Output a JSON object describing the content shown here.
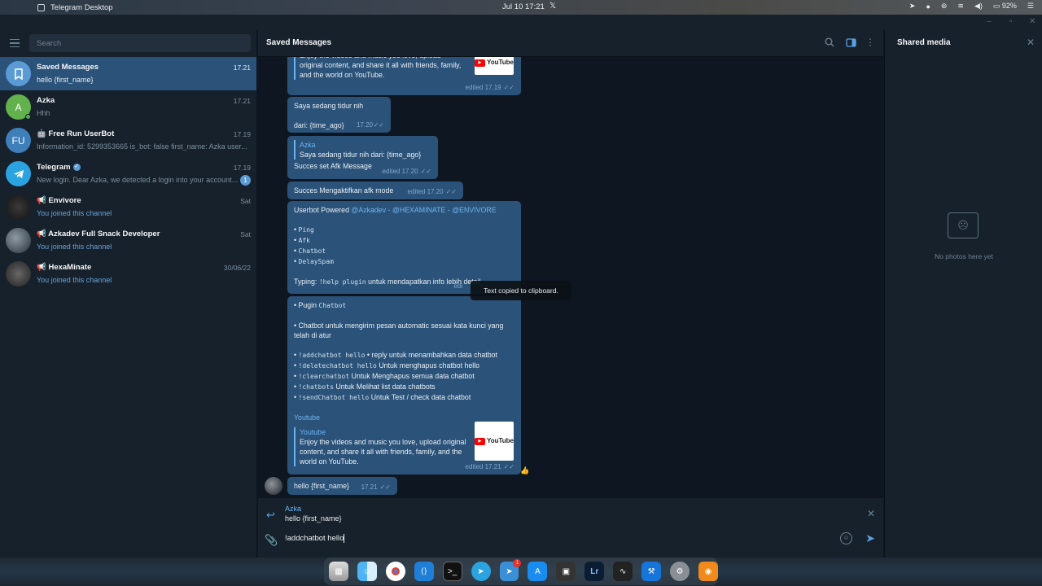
{
  "menubar": {
    "app_title": "Telegram Desktop",
    "date": "Jul 10",
    "time": "17:21",
    "battery": "92%"
  },
  "sidebar": {
    "search_placeholder": "Search",
    "chats": [
      {
        "name": "Saved Messages",
        "preview": "hello {first_name}",
        "time": "17.21",
        "active": true
      },
      {
        "name": "Azka",
        "initial": "A",
        "preview": "Hhh",
        "time": "17.21"
      },
      {
        "name": "Free Run UserBot",
        "initial": "FU",
        "preview": "Information_id: 5299353665 is_bot: false first_name: Azka user...",
        "time": "17.19"
      },
      {
        "name": "Telegram",
        "preview": "New login. Dear Azka, we detected a login into your account...",
        "time": "17.19",
        "unread": "1"
      },
      {
        "name": "Envivore",
        "preview": "You joined this channel",
        "time": "Sat"
      },
      {
        "name": "Azkadev Full Snack Developer",
        "preview": "You joined this channel",
        "time": "Sat"
      },
      {
        "name": "HexaMinate",
        "preview": "You joined this channel",
        "time": "30/06/22"
      }
    ]
  },
  "chat": {
    "title": "Saved Messages",
    "messages": {
      "m0_text": "Enjoy the videos and music you love, upload original content, and share it all with friends, family, and the world on YouTube.",
      "m0_meta": "edited 17.19",
      "m1_line1": "Saya sedang tidur nih",
      "m1_line2": "dari: {time_ago}",
      "m1_meta": "17.20",
      "m2_quote_name": "Azka",
      "m2_quote_text": "Saya sedang tidur nih  dari: {time_ago}",
      "m2_text": "Succes set Afk Message",
      "m2_meta": "edited 17.20",
      "m3_text": "Succes Mengaktifkan afk mode",
      "m3_meta": "edited 17.20",
      "m4_intro": "Userbot Powered",
      "m4_links": "@Azkadev - @HEXAMINATE - @ENVIVORE",
      "m4_items": [
        "Ping",
        "Afk",
        "Chatbot",
        "DelaySpam"
      ],
      "m4_typing": "Typing:",
      "m4_cmd": "!help plugin",
      "m4_tail": "untuk mendapatkan info lebih detail",
      "m4_meta": "edi",
      "m5_title_pre": "• Pugin",
      "m5_title_code": "Chatbot",
      "m5_desc": "• Chatbot untuk mengirim pesan automatic sesuai kata kunci yang telah di atur",
      "m5_cmds": [
        {
          "code": "!addchatbot hello",
          "text": "• reply untuk menambahkan data chatbot"
        },
        {
          "code": "!deletechatbot hello",
          "text": "Untuk menghapus chatbot hello"
        },
        {
          "code": "!clearchatbot",
          "text": "Untuk Menghapus semua data chatbot"
        },
        {
          "code": "!chatbots",
          "text": "Untuk Melihat list data chatbots"
        },
        {
          "code": "!sendChatbot hello",
          "text": "Untuk Test / check data chatbot"
        }
      ],
      "m5_link": "Youtube",
      "m5_preview_title": "Youtube",
      "m5_preview_text": "Enjoy the videos and music you love, upload original content, and share it all with friends, family, and the world on YouTube.",
      "m5_meta": "edited 17.21",
      "m6_text": "hello {first_name}",
      "m6_meta": "17.21",
      "yt_label": "YouTube"
    },
    "toast": "Text copied to clipboard."
  },
  "compose": {
    "reply_name": "Azka",
    "reply_text": "hello {first_name}",
    "input_value": "!addchatbot hello"
  },
  "shared": {
    "title": "Shared media",
    "empty": "No photos here yet"
  },
  "colors": {
    "bubble": "#2b5278",
    "accent": "#6ab3f3",
    "panel": "#17212b",
    "background": "#0e1621"
  },
  "dock_icons": [
    "launchpad",
    "finder",
    "chrome",
    "vscode",
    "terminal",
    "telegram",
    "telegram-notify",
    "app-store",
    "panel",
    "lightroom",
    "inkscape",
    "xcode",
    "settings",
    "blender"
  ]
}
